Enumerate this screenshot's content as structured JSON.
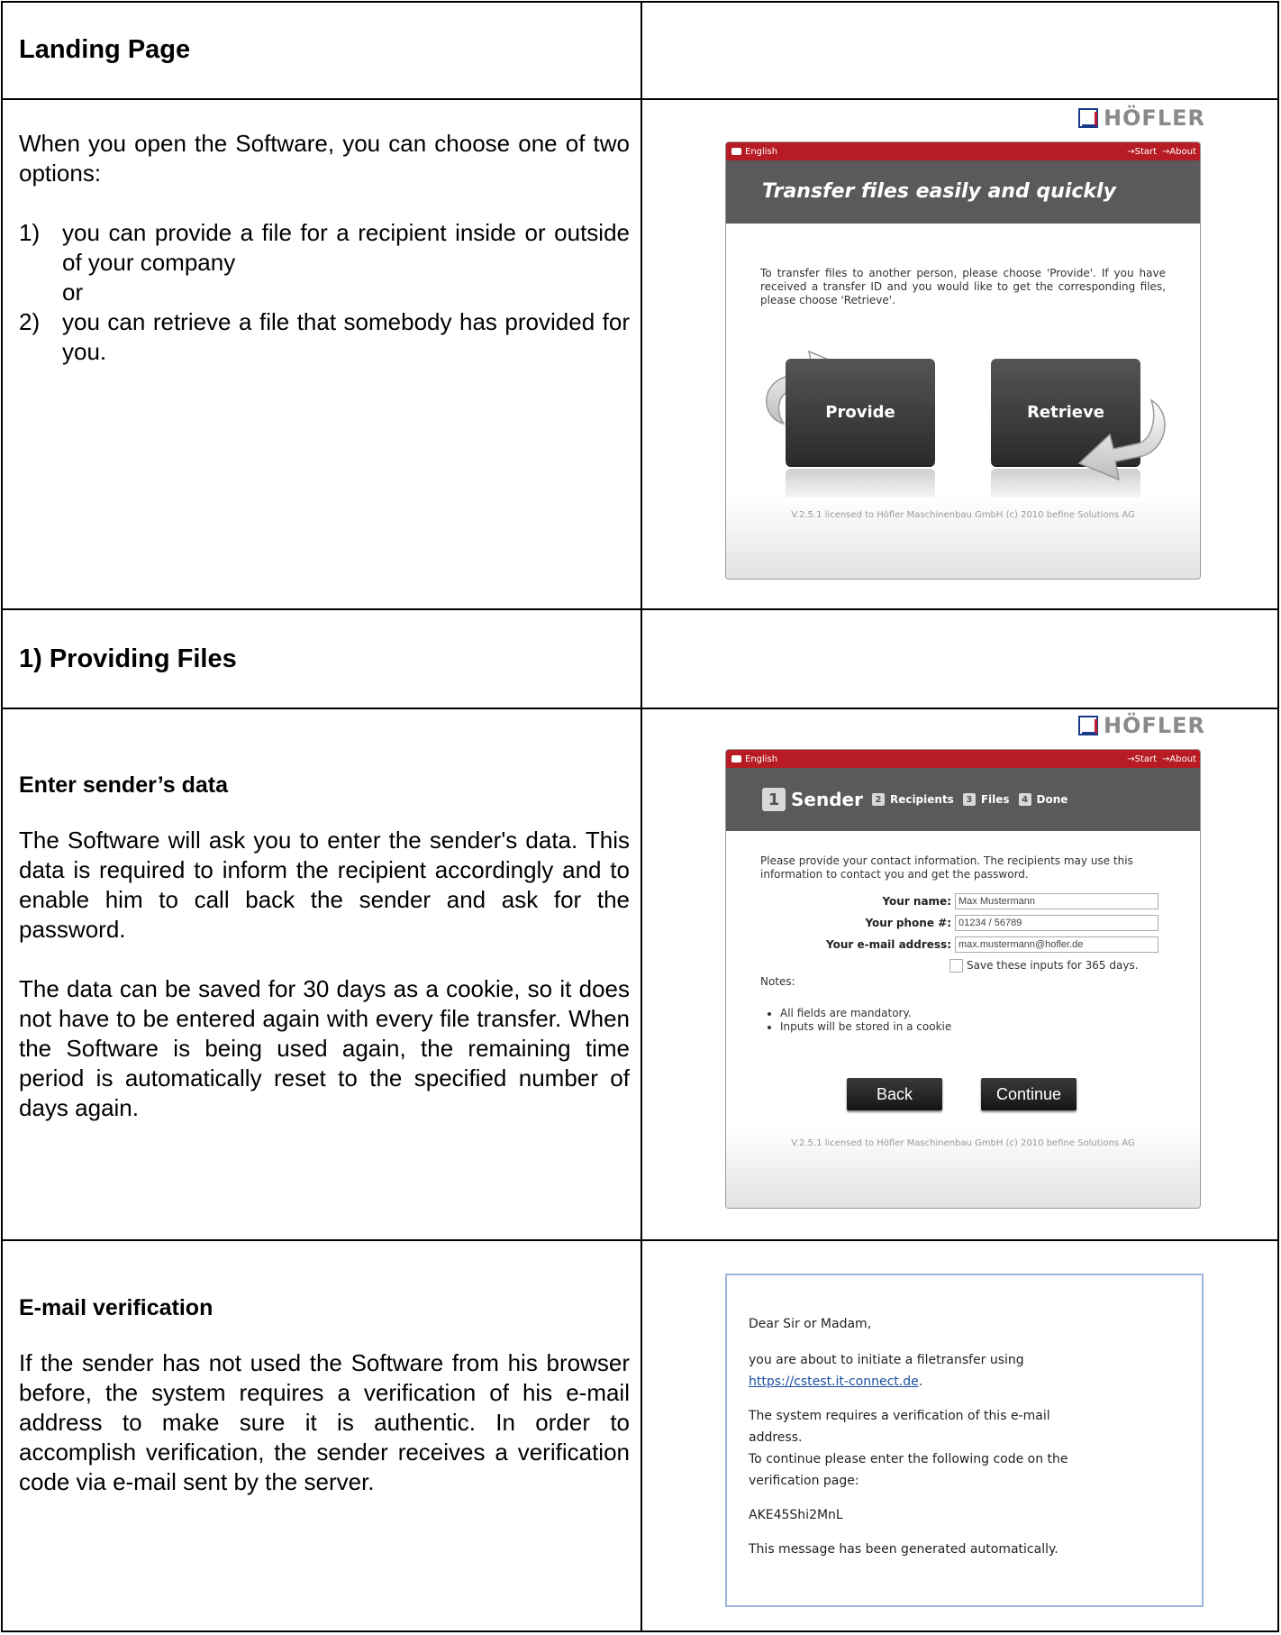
{
  "landing": {
    "heading": "Landing Page",
    "intro": "When you open the Software, you can choose one of two options:",
    "options": [
      {
        "num": "1)",
        "text": "you can provide a file for a recipient inside or outside of your company"
      },
      {
        "num": "2)",
        "text": "you can retrieve a file that somebody has provided for you."
      }
    ],
    "or": "or",
    "screen": {
      "logo": "HÖFLER",
      "lang": "English",
      "links": [
        "→Start",
        "→About"
      ],
      "title": "Transfer files easily and quickly",
      "text": "To transfer files to another person, please choose 'Provide'. If you have received a transfer ID and you would like to get the corresponding files, please choose 'Retrieve'.",
      "provide": "Provide",
      "retrieve": "Retrieve",
      "footer": "V.2.5.1 licensed to Höfler Maschinenbau GmbH (c) 2010 befine Solutions AG"
    }
  },
  "providing": {
    "heading": "1)  Providing Files",
    "sender": {
      "subheading": "Enter sender’s data",
      "para1": "The Software will ask you to enter the sender's data. This data is required to inform the recipient accordingly and to enable him to call back the sender and ask for the password.",
      "para2": "The data can be saved for 30 days as a cookie, so it does not have to be entered again with every file transfer. When the Software is being used again, the remaining time period is automatically reset to the specified number of days again.",
      "screen": {
        "logo": "HÖFLER",
        "lang": "English",
        "links": [
          "→Start",
          "→About"
        ],
        "steps": [
          {
            "num": "1",
            "label": "Sender"
          },
          {
            "num": "2",
            "label": "Recipients"
          },
          {
            "num": "3",
            "label": "Files"
          },
          {
            "num": "4",
            "label": "Done"
          }
        ],
        "intro": "Please provide your contact information. The recipients may use this information to contact you and get the password.",
        "fields": [
          {
            "label": "Your name:",
            "value": "Max Mustermann"
          },
          {
            "label": "Your phone #:",
            "value": "01234 / 56789"
          },
          {
            "label": "Your e-mail address:",
            "value": "max.mustermann@hofler.de"
          }
        ],
        "save_label": "Save these inputs for 365 days.",
        "notes_label": "Notes:",
        "notes": [
          "All fields are mandatory.",
          "Inputs will be stored in a cookie"
        ],
        "back": "Back",
        "continue": "Continue",
        "footer": "V.2.5.1 licensed to Höfler Maschinenbau GmbH (c) 2010 befine Solutions AG"
      }
    },
    "verification": {
      "subheading": "E-mail verification",
      "para": "If the sender has not used the Software from his browser before, the system requires a verification of his e-mail address to make sure it is authentic. In order to accomplish verification, the sender receives a verification code via e-mail sent by the server.",
      "email": {
        "greeting": "Dear Sir or Madam,",
        "line1": "you are about to initiate a filetransfer using",
        "link": "https://cstest.it-connect.de",
        "link_suffix": ".",
        "line2": "The system requires a  verification of this e-mail address.",
        "line3": "To continue please enter the following code on the verification page:",
        "code": "AKE45Shi2MnL",
        "closing": "This message has been generated automatically."
      }
    }
  }
}
